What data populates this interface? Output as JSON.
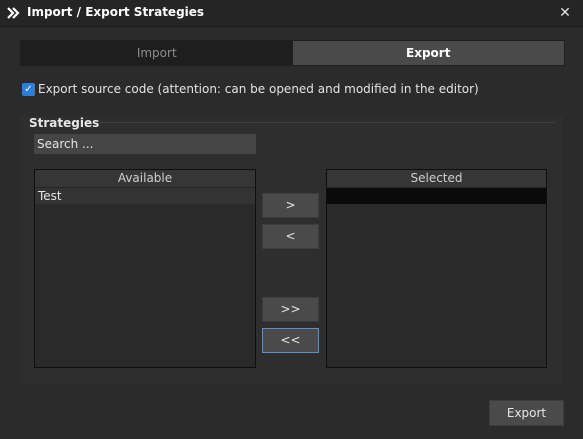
{
  "window": {
    "title": "Import / Export Strategies",
    "close_glyph": "✕",
    "icon": "double-chevron-right-icon"
  },
  "tabs": [
    {
      "label": "Import",
      "active": false
    },
    {
      "label": "Export",
      "active": true
    }
  ],
  "options": {
    "export_source_code": {
      "checked": true,
      "label": "Export source code (attention: can be opened and modified in the editor)"
    }
  },
  "strategies": {
    "group_title": "Strategies",
    "search_placeholder": "Search ...",
    "available": {
      "header": "Available",
      "items": [
        "Test"
      ]
    },
    "selected": {
      "header": "Selected",
      "items": [
        ""
      ]
    },
    "buttons": {
      "add": ">",
      "remove": "<",
      "add_all": ">>",
      "remove_all": "<<"
    }
  },
  "footer": {
    "export_label": "Export"
  },
  "colors": {
    "accent": "#2f7fd8",
    "background": "#2b2b2b",
    "focus_border": "#5b8fd0"
  }
}
